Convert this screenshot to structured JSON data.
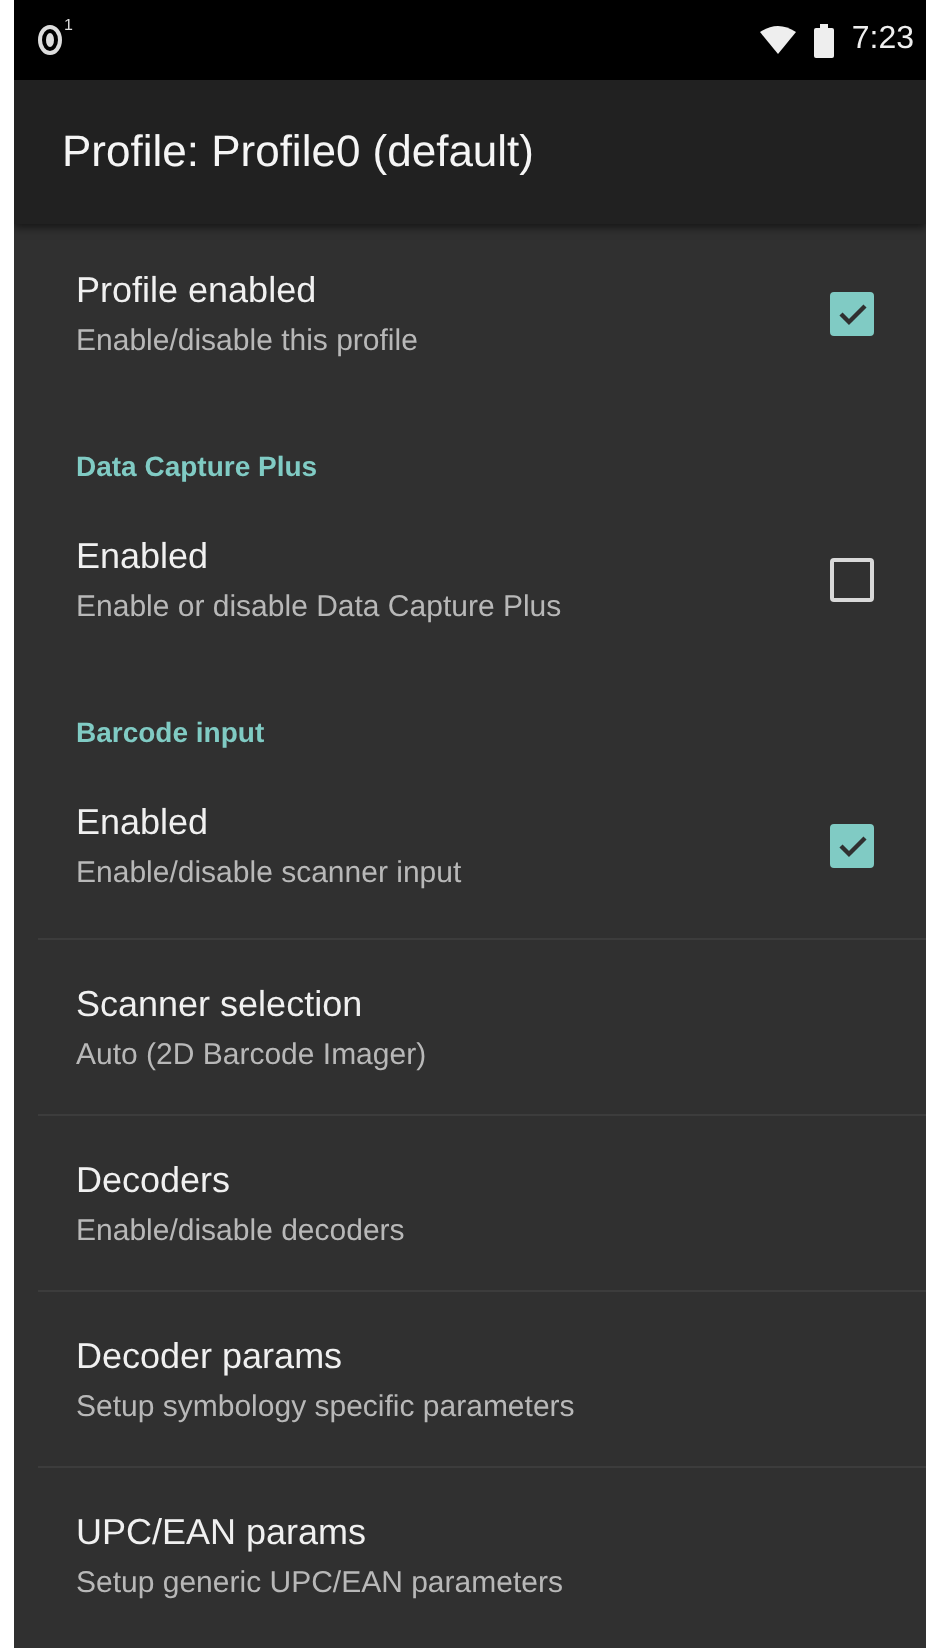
{
  "status_bar": {
    "notification_badge": "1",
    "time": "7:23"
  },
  "app_bar": {
    "title": "Profile: Profile0 (default)"
  },
  "items": [
    {
      "kind": "checkbox",
      "title": "Profile enabled",
      "summary": "Enable/disable this profile",
      "checked": true
    },
    {
      "kind": "category",
      "title": "Data Capture Plus"
    },
    {
      "kind": "checkbox",
      "title": "Enabled",
      "summary": "Enable or disable Data Capture Plus",
      "checked": false
    },
    {
      "kind": "category",
      "title": "Barcode input"
    },
    {
      "kind": "checkbox",
      "title": "Enabled",
      "summary": "Enable/disable scanner input",
      "checked": true
    },
    {
      "kind": "link",
      "title": "Scanner selection",
      "summary": "Auto (2D Barcode Imager)"
    },
    {
      "kind": "link",
      "title": "Decoders",
      "summary": "Enable/disable decoders"
    },
    {
      "kind": "link",
      "title": "Decoder params",
      "summary": "Setup symbology specific parameters"
    },
    {
      "kind": "link",
      "title": "UPC/EAN params",
      "summary": "Setup generic UPC/EAN parameters"
    }
  ]
}
